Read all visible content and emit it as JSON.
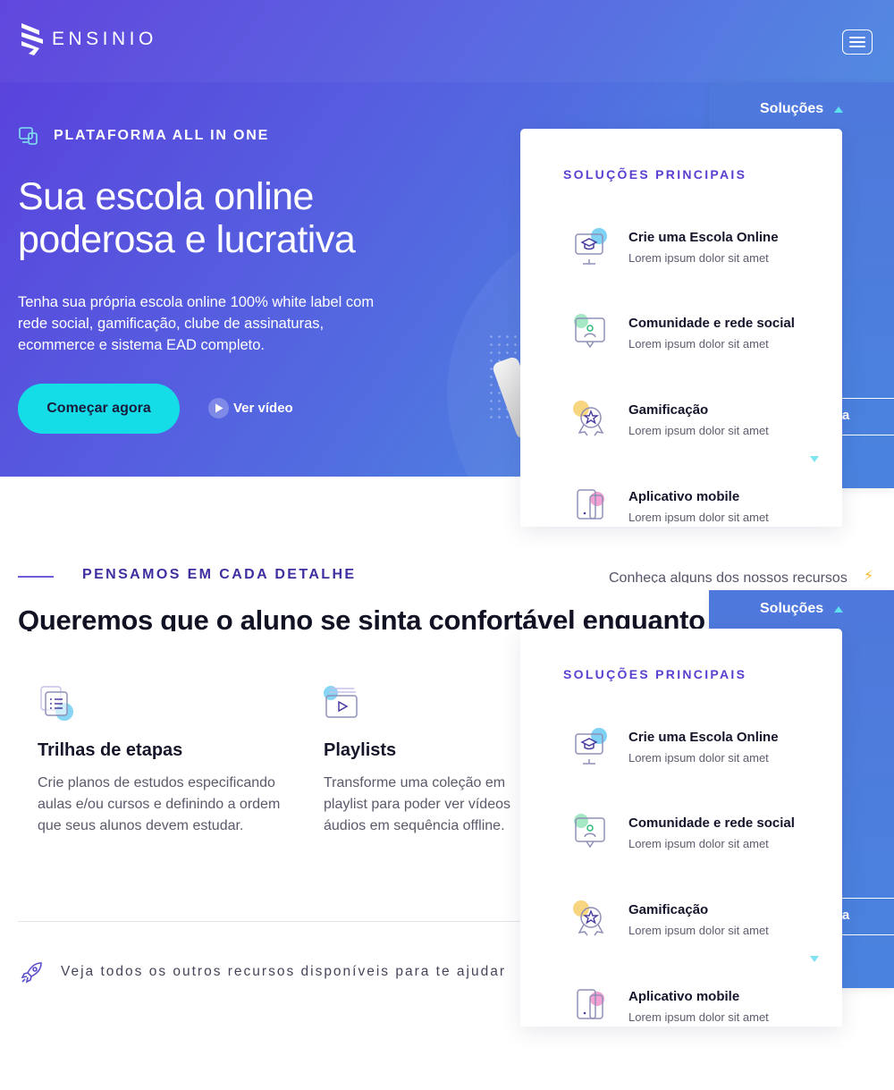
{
  "brand": {
    "name": "ENSINIO"
  },
  "hero": {
    "eyebrow": "PLATAFORMA ALL IN ONE",
    "title_line1": "Sua escola online",
    "title_line2": "poderosa e lucrativa",
    "description": "Tenha sua própria escola online 100% white label com rede social, gamificação, clube de assinaturas, ecommerce e sistema EAD completo.",
    "cta_label": "Começar agora",
    "video_label": "Ver vídeo"
  },
  "menu": {
    "solutions_label": "Soluções",
    "partial_button_label": "ra"
  },
  "dropdown": {
    "title": "SOLUÇÕES PRINCIPAIS",
    "items": [
      {
        "label": "Crie uma Escola Online",
        "sub": "Lorem ipsum dolor sit amet",
        "icon": "graduation-screen-icon"
      },
      {
        "label": "Comunidade e rede social",
        "sub": "Lorem ipsum dolor sit amet",
        "icon": "community-icon"
      },
      {
        "label": "Gamificação",
        "sub": "Lorem ipsum dolor sit amet",
        "icon": "badge-star-icon"
      },
      {
        "label": "Aplicativo mobile",
        "sub": "Lorem ipsum dolor sit amet",
        "icon": "mobile-app-icon"
      }
    ]
  },
  "features_section": {
    "eyebrow": "PENSAMOS EM CADA DETALHE",
    "side_link": "Conheça alguns dos nossos recursos",
    "heading": "Queremos que o aluno se sinta confortável enquanto e",
    "features": [
      {
        "title": "Trilhas de etapas",
        "description": "Crie planos de estudos especificando aulas e/ou cursos e definindo a ordem que seus alunos devem estudar.",
        "icon": "list-steps-icon"
      },
      {
        "title": "Playlists",
        "desc_line1": "Transforme uma coleção em",
        "desc_line2": "playlist para poder ver vídeos",
        "desc_line3": "áudios em sequência offline.",
        "icon": "playlist-icon"
      }
    ],
    "more_text": "Veja todos os outros recursos disponíveis para te ajudar"
  },
  "colors": {
    "hero_start": "#5a3fdc",
    "hero_end": "#4a9be2",
    "cta": "#15dde8",
    "accent_purple": "#5b3fd0",
    "panel_blue": "#4f78dc"
  }
}
